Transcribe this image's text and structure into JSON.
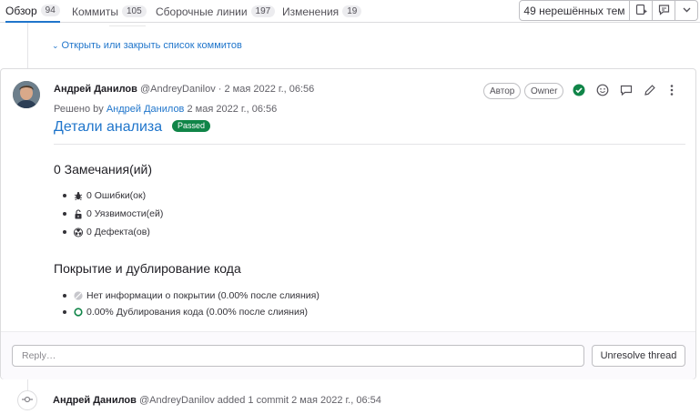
{
  "tabs": [
    {
      "label": "Обзор",
      "count": "94"
    },
    {
      "label": "Коммиты",
      "count": "105"
    },
    {
      "label": "Сборочные линии",
      "count": "197"
    },
    {
      "label": "Изменения",
      "count": "19"
    }
  ],
  "header": {
    "unresolved_threads": "49 нерешённых тем",
    "icons": [
      "add-todo-icon",
      "comment-icon",
      "chevron-down-icon"
    ]
  },
  "commits_toggle": "Открыть или закрыть список коммитов",
  "comment": {
    "author_name": "Андрей Данилов",
    "author_handle": "@AndreyDanilov",
    "separator": "·",
    "date": "2 мая 2022 г., 06:56",
    "badges": [
      "Автор",
      "Owner"
    ],
    "resolved_prefix": "Решено by",
    "resolved_by": "Андрей Данилов",
    "resolved_date": "2 мая 2022 г., 06:56",
    "title": "Детали анализа",
    "status": "Passed",
    "issues_heading": "0 Замечания(ий)",
    "issues": [
      {
        "icon": "bug-icon",
        "text": "0 Ошибки(ок)"
      },
      {
        "icon": "unlock-icon",
        "text": "0 Уязвимости(ей)"
      },
      {
        "icon": "radiation-icon",
        "text": "0 Дефекта(ов)"
      }
    ],
    "coverage_heading": "Покрытие и дублирование кода",
    "coverage": [
      {
        "icon": "no-coverage-icon",
        "text": "Нет информации о покрытии (0.00% после слияния)"
      },
      {
        "icon": "duplication-circle-icon",
        "text": "0.00% Дублирования кода (0.00% после слияния)"
      }
    ]
  },
  "reply": {
    "placeholder": "Reply…",
    "unresolve_label": "Unresolve thread"
  },
  "system_note": {
    "author_name": "Андрей Данилов",
    "author_handle": "@AndreyDanilov",
    "action": "added 1 commit",
    "date": "2 мая 2022 г., 06:54"
  },
  "colors": {
    "link": "#1f75cb",
    "passed": "#108548",
    "resolved_check": "#108548"
  }
}
